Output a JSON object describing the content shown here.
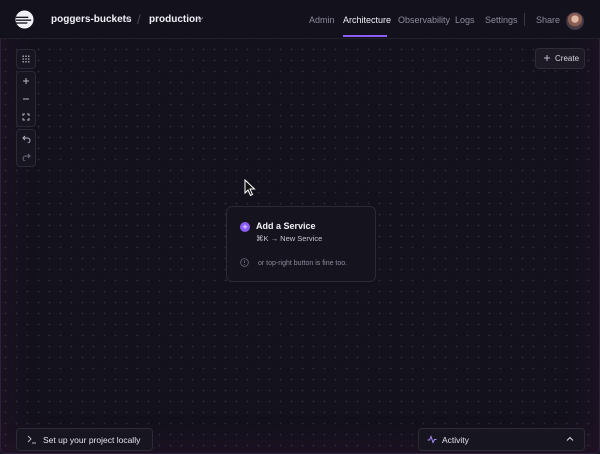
{
  "header": {
    "project_name": "poggers-buckets",
    "environment": "production",
    "tabs": [
      {
        "label": "Admin"
      },
      {
        "label": "Architecture"
      },
      {
        "label": "Observability"
      },
      {
        "label": "Logs"
      },
      {
        "label": "Settings"
      }
    ],
    "active_tab": "Architecture",
    "share_label": "Share"
  },
  "toolbar": {
    "tools": [
      "grid-icon",
      "zoom-in-icon",
      "zoom-out-icon",
      "fit-view-icon",
      "undo-icon",
      "redo-icon"
    ]
  },
  "create_button": {
    "label": "Create"
  },
  "empty_state": {
    "title": "Add a Service",
    "shortcut": "⌘K → New Service",
    "hint": "or top-right button is fine too."
  },
  "footer": {
    "setup_label": "Set up your project locally",
    "activity_label": "Activity"
  },
  "colors": {
    "background": "#13111c",
    "accent": "#8b5cf6",
    "panel": "#17151f",
    "border": "#2c2938"
  }
}
